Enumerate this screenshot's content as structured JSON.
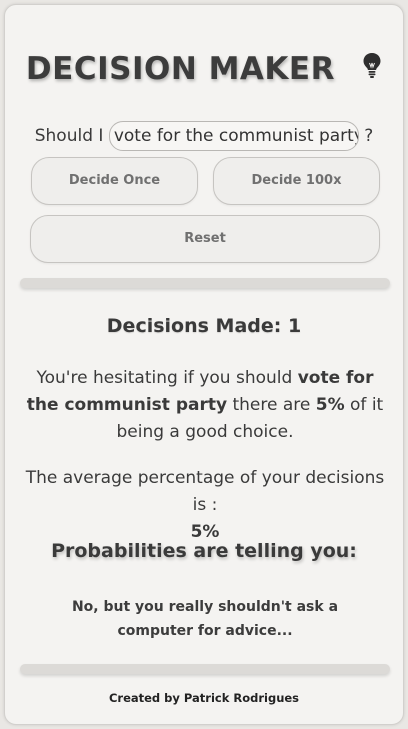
{
  "header": {
    "title": "DECISION MAKER",
    "icon": "lightbulb-icon"
  },
  "question": {
    "prefix": "Should I",
    "input_value": "vote for the communist party",
    "suffix": "?"
  },
  "buttons": {
    "decide_once": "Decide Once",
    "decide_100x": "Decide 100x",
    "reset": "Reset"
  },
  "results": {
    "decisions_label": "Decisions Made:",
    "decisions_count": "1",
    "sentence_prefix": "You're hesitating if you should",
    "sentence_topic": "vote for the communist party",
    "sentence_middle": "there are",
    "sentence_percent": "5%",
    "sentence_suffix": "of it being a good choice.",
    "average_label": "The average percentage of your decisions is :",
    "average_value": "5%",
    "probabilities_title": "Probabilities are telling you:",
    "advice": "No, but you really shouldn't ask a computer for advice..."
  },
  "footer": {
    "credit": "Created by Patrick Rodrigues"
  },
  "colors": {
    "background": "#e9e7e4",
    "card": "#f4f3f1",
    "text": "#3a3a3a",
    "button_text": "#707070"
  }
}
